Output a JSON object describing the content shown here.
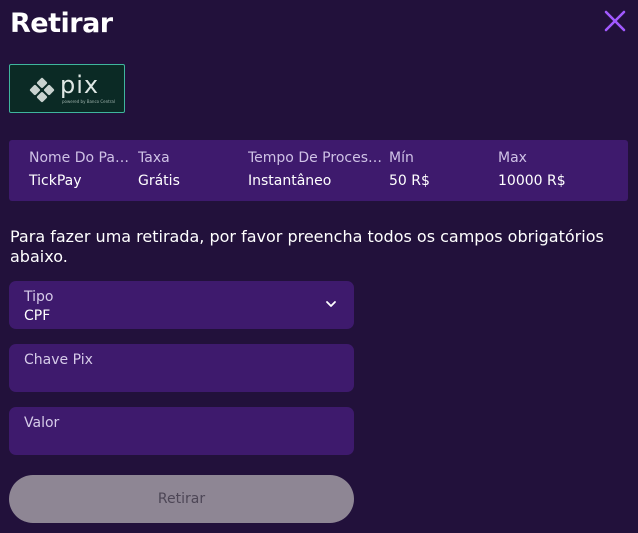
{
  "dialog": {
    "title": "Retirar",
    "close_icon": "close-icon"
  },
  "payment_method": {
    "logo_text": "pix",
    "logo_tagline": "powered by Banco Central",
    "brand_color": "#32bcad"
  },
  "info": {
    "headers": [
      "Nome Do Pag...",
      "Taxa",
      "Tempo De Process...",
      "Mín",
      "Max"
    ],
    "values": [
      "TickPay",
      "Grátis",
      "Instantâneo",
      "50 R$",
      "10000 R$"
    ]
  },
  "instructions": "Para fazer uma retirada, por favor preencha todos os campos obrigatórios abaixo.",
  "form": {
    "tipo_label": "Tipo",
    "tipo_value": "CPF",
    "chave_label": "Chave Pix",
    "chave_value": "",
    "valor_label": "Valor",
    "valor_value": ""
  },
  "submit_label": "Retirar",
  "colors": {
    "background": "#22113b",
    "panel": "#3e1a6d",
    "accent": "#a259ff",
    "button_disabled": "#8e8694"
  }
}
